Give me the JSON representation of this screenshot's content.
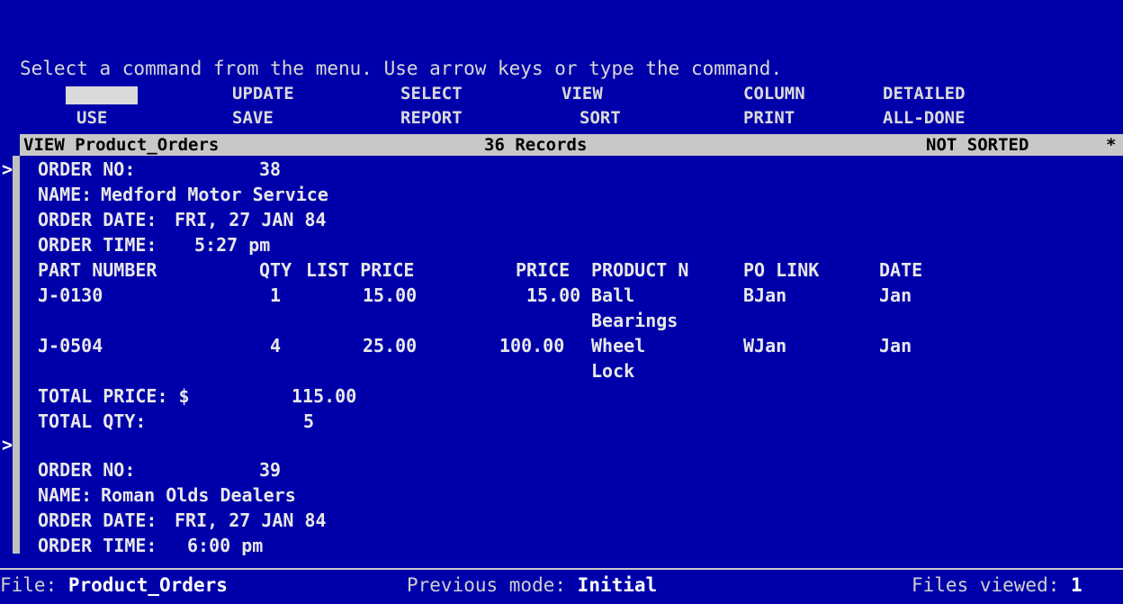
{
  "prompt": "Select a command from the menu. Use arrow keys or type the command.",
  "menu": {
    "row1": [
      "",
      "UPDATE",
      "SELECT",
      "VIEW",
      "COLUMN",
      "DETAILED"
    ],
    "row2": [
      "USE",
      "SAVE",
      "REPORT",
      "SORT",
      "PRINT",
      "ALL-DONE"
    ]
  },
  "status": {
    "view_name": "VIEW Product_Orders",
    "record_count": "36 Records",
    "sort_state": "NOT SORTED",
    "marker": "*"
  },
  "pointer": ">",
  "record1": {
    "order_no_label": "ORDER NO:",
    "order_no": "38",
    "name_label": "NAME:",
    "name": "Medford Motor Service",
    "date_label": "ORDER DATE:",
    "date": "FRI, 27 JAN 84",
    "time_label": "ORDER TIME:",
    "time": "5:27 pm",
    "columns": [
      "PART NUMBER",
      "QTY",
      "LIST PRICE",
      "PRICE",
      "PRODUCT N",
      "PO LINK",
      "DATE"
    ],
    "rows": [
      {
        "part": "J-0130",
        "qty": "1",
        "list_price": "15.00",
        "price": "15.00",
        "product_1": "Ball",
        "product_2": "Bearings",
        "po_link": "BJan",
        "date": "Jan"
      },
      {
        "part": "J-0504",
        "qty": "4",
        "list_price": "25.00",
        "price": "100.00",
        "product_1": "Wheel",
        "product_2": "Lock",
        "po_link": "WJan",
        "date": "Jan"
      }
    ],
    "total_price_label": "TOTAL PRICE: $",
    "total_price": "115.00",
    "total_qty_label": "TOTAL QTY:",
    "total_qty": "5"
  },
  "record2": {
    "order_no_label": "ORDER NO:",
    "order_no": "39",
    "name_label": "NAME:",
    "name": "Roman Olds Dealers",
    "date_label": "ORDER DATE:",
    "date": "FRI, 27 JAN 84",
    "time_label": "ORDER TIME:",
    "time": "6:00 pm"
  },
  "footer": {
    "file_label": "File:",
    "file": "Product_Orders",
    "mode_label": "Previous mode:",
    "mode": "Initial",
    "viewed_label": "Files viewed:",
    "viewed": "1"
  }
}
